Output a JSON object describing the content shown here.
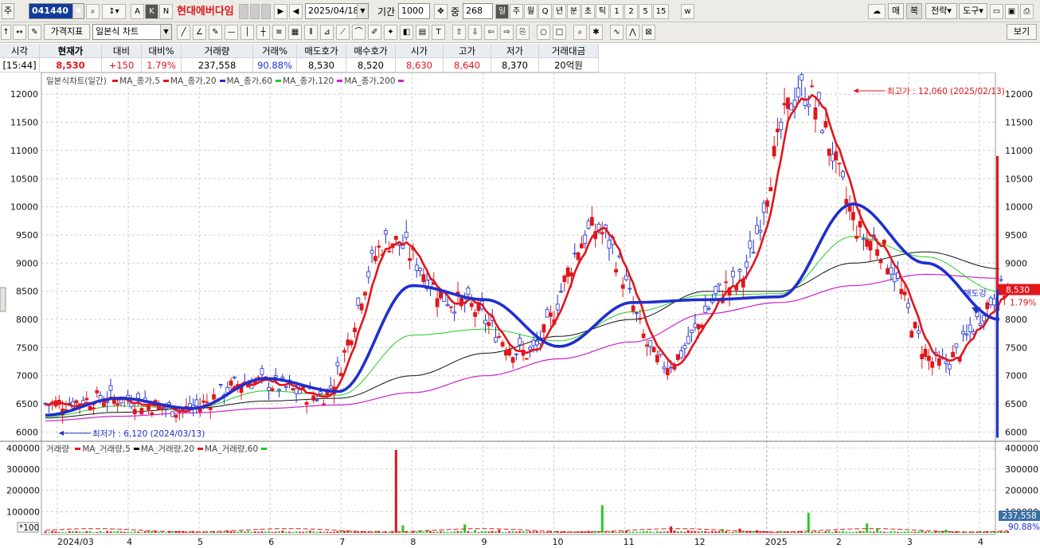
{
  "toolbar1": {
    "market_label": "주",
    "code": "041440",
    "name": "현대에버다임",
    "letters": [
      "A",
      "K",
      "N"
    ],
    "date": "2025/04/18",
    "period_label": "기간",
    "period_value": "1000",
    "count_label": "중",
    "count_value": "268",
    "periods": [
      "일",
      "주",
      "월",
      "Q",
      "년",
      "분",
      "초",
      "틱",
      "1",
      "2",
      "5",
      "15"
    ],
    "right_buttons": [
      "매",
      "복",
      "전략",
      "도구"
    ]
  },
  "toolbar2": {
    "indicator_btn": "가격지표",
    "chart_type": "일본식 차트",
    "view_btn": "보기"
  },
  "quote": {
    "headers": [
      "시각",
      "현재가",
      "대비",
      "대비%",
      "거래량",
      "거래%",
      "매도호가",
      "매수호가",
      "시가",
      "고가",
      "저가",
      "거래대금"
    ],
    "values": [
      "[15:44]",
      "8,530",
      "+150",
      "1.79%",
      "237,558",
      "90.88%",
      "8,530",
      "8,520",
      "8,630",
      "8,640",
      "8,370",
      "20억원"
    ]
  },
  "legend_main": {
    "title": "일본식차트(일간)",
    "items": [
      {
        "label": "MA_종가,5",
        "color": "#e0161b"
      },
      {
        "label": "MA_종가,20",
        "color": "#e0161b"
      },
      {
        "label": "MA_종가,60",
        "color": "#1f2fcf"
      },
      {
        "label": "MA_종가,120",
        "color": "#22cc22"
      },
      {
        "label": "MA_종가,200",
        "color": "#cc22cc"
      }
    ]
  },
  "legend_vol": {
    "title": "거래량",
    "items": [
      {
        "label": "MA_거래량,5",
        "color": "#e0161b"
      },
      {
        "label": "MA_거래량,20",
        "color": "#000000"
      },
      {
        "label": "MA_거래량,60",
        "color": "#e0161b"
      }
    ],
    "end_color": "#22cc22"
  },
  "annotations": {
    "high": "최고가 : 12,060 (2025/02/13)",
    "low": "최저가 : 6,120 (2024/03/13)",
    "sell": "매도강",
    "price_tag": "8,530",
    "pct_tag": "1.79%",
    "vol_tag": "237,558",
    "vol_pct_tag": "90.88%",
    "vol_unit": "*100"
  },
  "chart_data": {
    "type": "candlestick",
    "x_ticks": [
      "2024/03",
      "4",
      "5",
      "6",
      "7",
      "8",
      "9",
      "10",
      "11",
      "12",
      "2025",
      "2",
      "3",
      "4"
    ],
    "price_ticks": [
      6000,
      6500,
      7000,
      7500,
      8000,
      8500,
      9000,
      9500,
      10000,
      10500,
      11000,
      11500,
      12000
    ],
    "price_ylim": [
      5850,
      12300
    ],
    "volume_ticks": [
      100000,
      200000,
      300000,
      400000
    ],
    "volume_ylim": [
      0,
      420000
    ],
    "ma60_monthly": [
      6300,
      6600,
      6420,
      6950,
      6720,
      8600,
      8350,
      7520,
      8300,
      8350,
      8400,
      10050,
      9000,
      8000
    ],
    "ma120_monthly": [
      6250,
      6350,
      6420,
      6550,
      6600,
      7000,
      7400,
      7700,
      8000,
      8500,
      8500,
      9000,
      9200,
      8900
    ],
    "ma200_monthly": [
      6200,
      6280,
      6340,
      6420,
      6480,
      6700,
      7000,
      7300,
      7600,
      8100,
      8300,
      8600,
      8800,
      8730
    ],
    "close_monthly": [
      6500,
      6600,
      6400,
      6900,
      6650,
      9400,
      8300,
      7400,
      9600,
      7200,
      8600,
      12060,
      9400,
      7200,
      8530
    ],
    "volume_spikes": [
      0,
      2000,
      1500,
      8000,
      3000,
      390000,
      40000,
      10000,
      130000,
      30000,
      20000,
      95000,
      20000,
      15000
    ],
    "last": {
      "price": 8530,
      "change": 150,
      "change_pct": "1.79%",
      "volume": 237558
    }
  }
}
